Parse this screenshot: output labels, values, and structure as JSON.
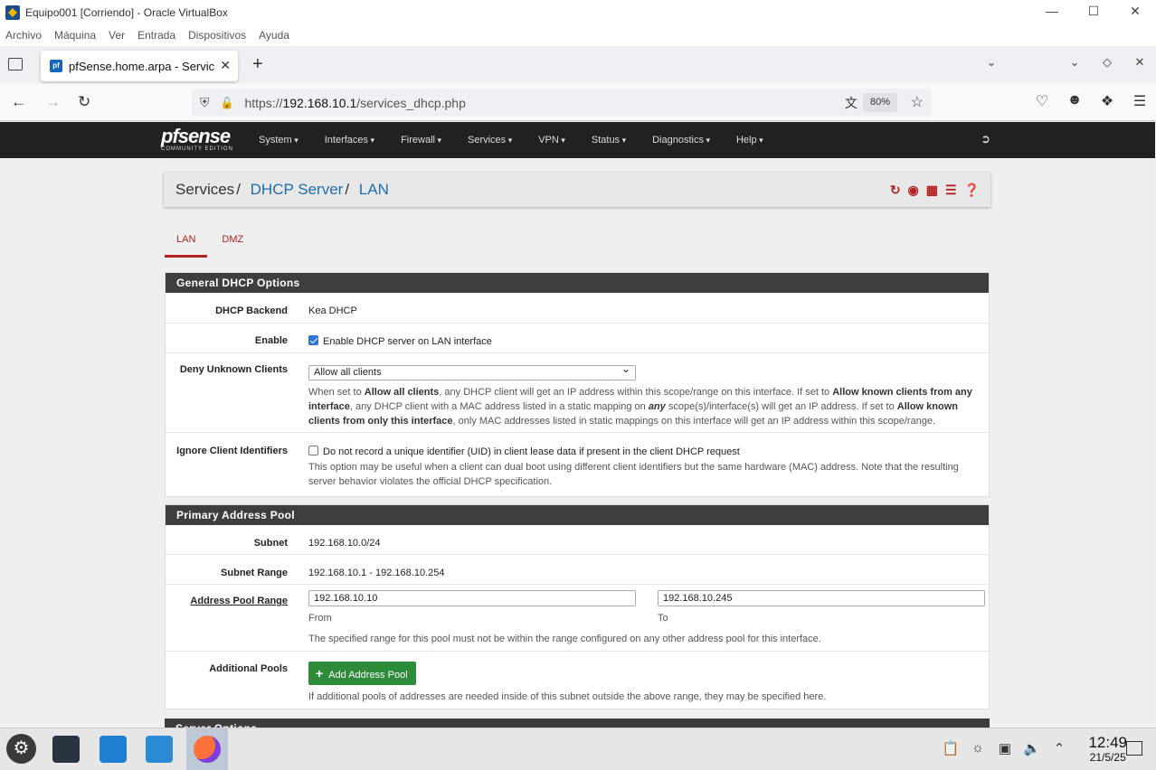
{
  "vbox": {
    "title": "Equipo001 [Corriendo] - Oracle VirtualBox",
    "menu": [
      "Archivo",
      "Máquina",
      "Ver",
      "Entrada",
      "Dispositivos",
      "Ayuda"
    ]
  },
  "browser": {
    "tab_title": "pfSense.home.arpa - Servic",
    "url_prefix": "https://",
    "url_host": "192.168.10.1",
    "url_path": "/services_dhcp.php",
    "zoom": "80%"
  },
  "pfsense": {
    "logo": "pfsense",
    "logo_sub": "COMMUNITY EDITION",
    "menu": [
      "System",
      "Interfaces",
      "Firewall",
      "Services",
      "VPN",
      "Status",
      "Diagnostics",
      "Help"
    ],
    "breadcrumb": {
      "root": "Services",
      "mid": "DHCP Server",
      "leaf": "LAN"
    },
    "tabs": [
      "LAN",
      "DMZ"
    ],
    "general": {
      "heading": "General DHCP Options",
      "backend_label": "DHCP Backend",
      "backend_value": "Kea DHCP",
      "enable_label": "Enable",
      "enable_text": "Enable DHCP server on LAN interface",
      "deny_label": "Deny Unknown Clients",
      "deny_value": "Allow all clients",
      "deny_help_1": "When set to ",
      "deny_help_b1": "Allow all clients",
      "deny_help_2": ", any DHCP client will get an IP address within this scope/range on this interface. If set to ",
      "deny_help_b2": "Allow known clients from any interface",
      "deny_help_3": ", any DHCP client with a MAC address listed in a static mapping on ",
      "deny_help_b3": "any",
      "deny_help_4": " scope(s)/interface(s) will get an IP address. If set to ",
      "deny_help_b4": "Allow known clients from only this interface",
      "deny_help_5": ", only MAC addresses listed in static mappings on this interface will get an IP address within this scope/range.",
      "ignore_label": "Ignore Client Identifiers",
      "ignore_text": "Do not record a unique identifier (UID) in client lease data if present in the client DHCP request",
      "ignore_help": "This option may be useful when a client can dual boot using different client identifiers but the same hardware (MAC) address. Note that the resulting server behavior violates the official DHCP specification."
    },
    "pool": {
      "heading": "Primary Address Pool",
      "subnet_label": "Subnet",
      "subnet_value": "192.168.10.0/24",
      "range_label": "Subnet Range",
      "range_value": "192.168.10.1 - 192.168.10.254",
      "apr_label": "Address Pool Range",
      "from_value": "192.168.10.10",
      "from_label": "From",
      "to_value": "192.168.10.245",
      "to_label": "To",
      "apr_help": "The specified range for this pool must not be within the range configured on any other address pool for this interface.",
      "additional_label": "Additional Pools",
      "add_button": "Add Address Pool",
      "additional_help": "If additional pools of addresses are needed inside of this subnet outside the above range, they may be specified here."
    },
    "server_heading": "Server Options"
  },
  "taskbar": {
    "time": "12:49",
    "date": "21/5/25"
  }
}
